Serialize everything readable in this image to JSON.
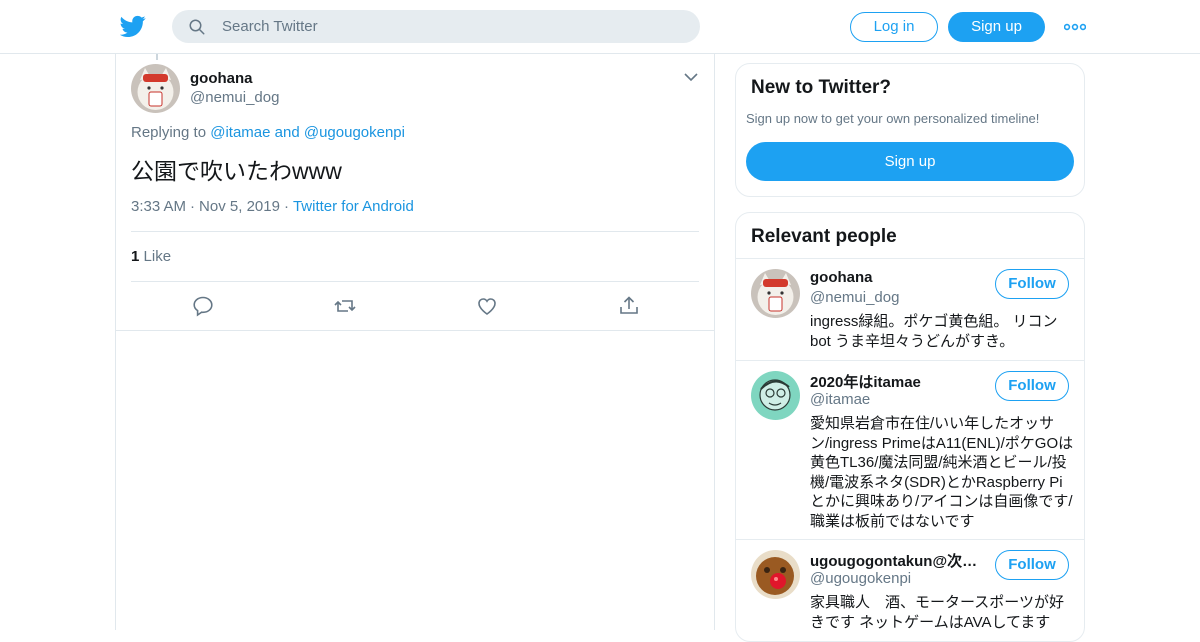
{
  "header": {
    "search_placeholder": "Search Twitter",
    "login_label": "Log in",
    "signup_label": "Sign up"
  },
  "tweet": {
    "name": "goohana",
    "handle": "@nemui_dog",
    "replying_prefix": "Replying to",
    "reply_to_1": "@itamae",
    "reply_and": "and",
    "reply_to_2": "@ugougokenpi",
    "text": "公園で吹いたわwww",
    "time": "3:33 AM",
    "date": "Nov 5, 2019",
    "source": "Twitter for Android",
    "like_count": "1",
    "like_label": "Like"
  },
  "signup_card": {
    "title": "New to Twitter?",
    "subtitle": "Sign up now to get your own personalized timeline!",
    "button": "Sign up"
  },
  "relevant": {
    "title": "Relevant people",
    "follow_label": "Follow",
    "people": [
      {
        "name": "goohana",
        "handle": "@nemui_dog",
        "bio": "ingress緑組。ポケゴ黄色組。 リコンbot うま辛坦々うどんがすき。"
      },
      {
        "name": "2020年はitamae",
        "handle": "@itamae",
        "bio": "愛知県岩倉市在住/いい年したオッサン/ingress PrimeはA11(ENL)/ポケGOは黄色TL36/魔法同盟/純米酒とビール/投機/電波系ネタ(SDR)とかRaspberry Piとかに興味あり/アイコンは自画像です/職業は板前ではないです"
      },
      {
        "name": "ugougogontakun@次回...",
        "handle": "@ugougokenpi",
        "bio": "家具職人　酒、モータースポーツが好きです ネットゲームはAVAしてます"
      }
    ]
  },
  "colors": {
    "accent": "#1da1f2",
    "link": "#1b95e0",
    "muted": "#657786"
  },
  "icons": [
    "twitter-bird-icon",
    "search-icon",
    "more-icon",
    "chevron-down-icon",
    "reply-icon",
    "retweet-icon",
    "like-icon",
    "share-icon"
  ]
}
